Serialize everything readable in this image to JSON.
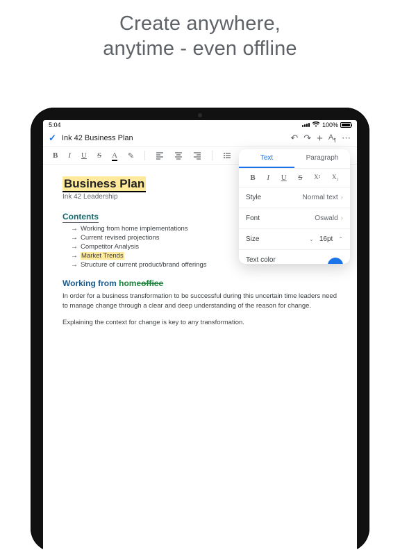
{
  "tagline_line1": "Create anywhere,",
  "tagline_line2": "anytime - even offline",
  "status": {
    "time": "5:04",
    "battery": "100%"
  },
  "header": {
    "title": "Ink 42 Business Plan",
    "icons": {
      "undo": "↶",
      "redo": "↷",
      "plus": "+",
      "format": "A",
      "more": "⋯"
    }
  },
  "toolbar": {
    "b": "B",
    "i": "I",
    "u": "U",
    "s": "S",
    "a": "A",
    "hl": "✎"
  },
  "doc": {
    "title": "Business Plan",
    "subtitle": "Ink 42 Leadership",
    "contents_heading": "Contents",
    "bullets": [
      "Working from home implementations",
      "Current revised projections",
      "Competitor Analysis",
      "Market Trends",
      "Structure of current product/brand offerings"
    ],
    "section_label": "Working from ",
    "section_home": "home",
    "section_strike": "office",
    "para1": "In order for a business transformation to be successful during this uncertain time leaders need to manage change through a clear and deep understanding of the reason for change.",
    "para2": "Explaining the context for change is key to any transformation."
  },
  "popover": {
    "tabs": {
      "text": "Text",
      "paragraph": "Paragraph"
    },
    "fmt": {
      "b": "B",
      "i": "I",
      "u": "U",
      "s": "S",
      "sup": "X²",
      "sub": "X₂"
    },
    "style": {
      "label": "Style",
      "value": "Normal text"
    },
    "font": {
      "label": "Font",
      "value": "Oswald"
    },
    "size": {
      "label": "Size",
      "value": "16pt"
    },
    "textcolor": {
      "label": "Text color"
    }
  }
}
